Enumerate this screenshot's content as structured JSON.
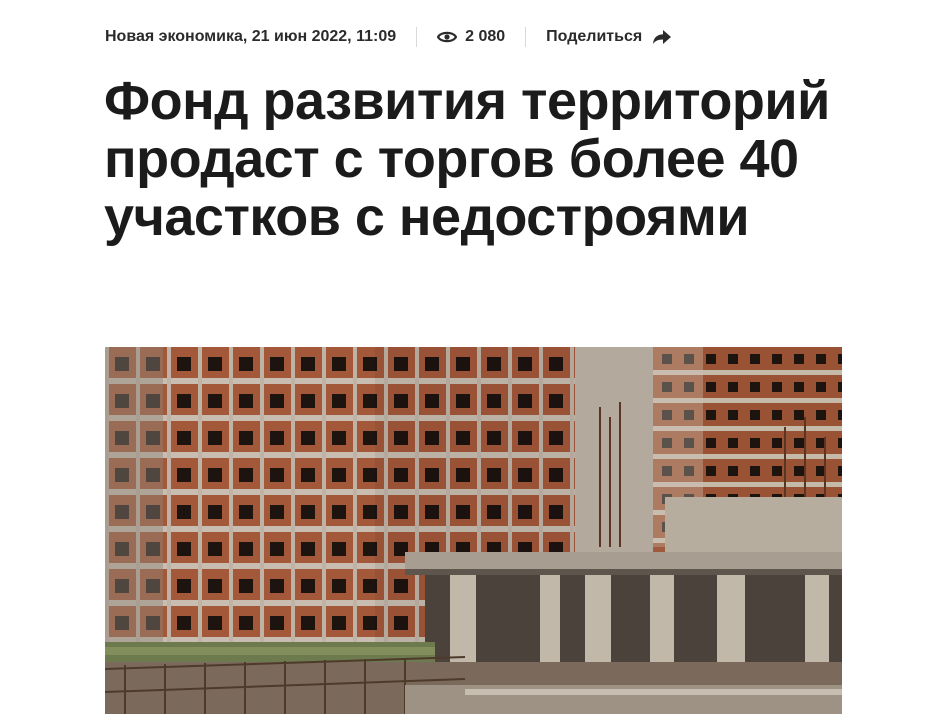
{
  "article": {
    "source_date": "Новая экономика, 21 июн 2022, 11:09",
    "views": "2 080",
    "share_label": "Поделиться",
    "title": "Фонд развития территорий продаст с торгов более 40 участков с недостроями",
    "icons": {
      "views": "eye-icon",
      "share": "share-arrow-icon"
    },
    "photo": {
      "subject": "unfinished-brick-apartment-buildings"
    }
  },
  "colors": {
    "text": "#1b1b1b",
    "meta_text": "#2b2b2b",
    "divider": "#d9d9d9",
    "brick": "#9e5a3c",
    "concrete": "#bdb3a6"
  }
}
